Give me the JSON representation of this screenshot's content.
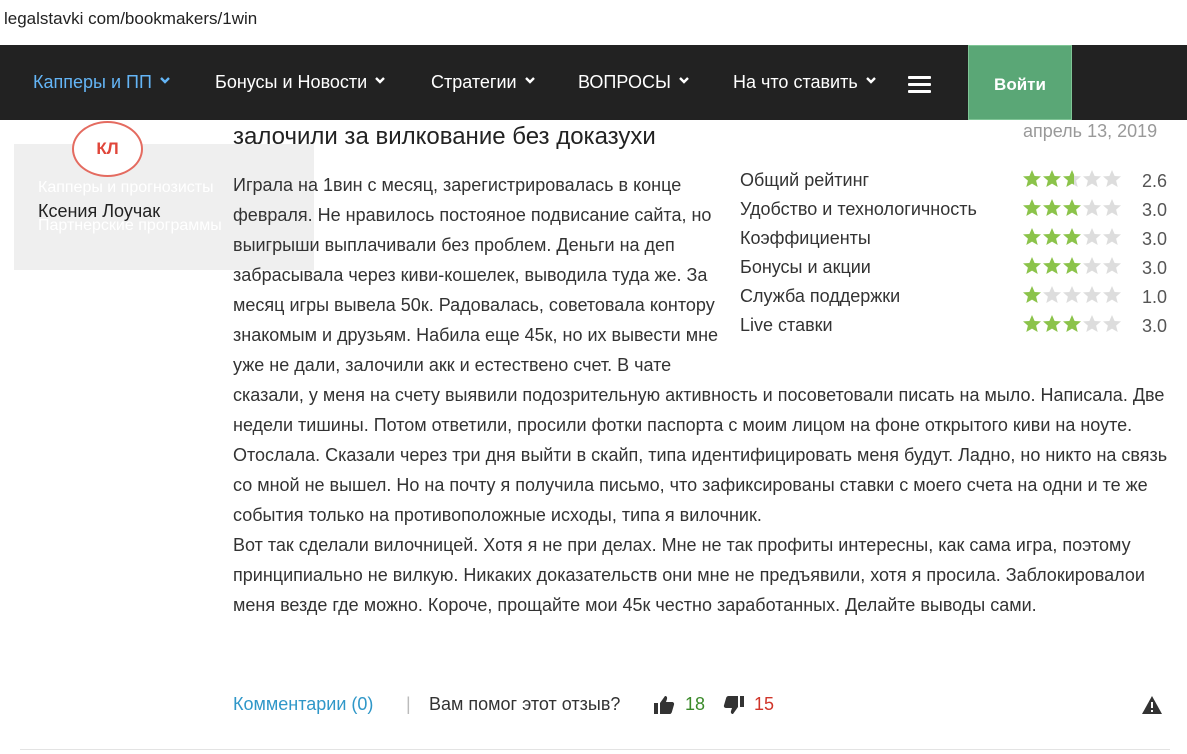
{
  "browser": {
    "url": "legalstavki com/bookmakers/1win"
  },
  "nav": {
    "items": [
      {
        "label": "Капперы и ПП",
        "active": true
      },
      {
        "label": "Бонусы и Новости",
        "active": false
      },
      {
        "label": "Стратегии",
        "active": false
      },
      {
        "label": "ВОПРОСЫ",
        "active": false
      },
      {
        "label": "На что ставить",
        "active": false
      }
    ],
    "menu_icon": "hamburger-icon",
    "login_label": "Войти"
  },
  "sidebar": {
    "ghost_item_1": "Капперы и прогнозисты",
    "ghost_item_2": "Партнерские программы"
  },
  "review": {
    "author_initials": "КЛ",
    "author_name": "Ксения Лоучак",
    "title": "залочили за вилкование без доказухи",
    "date": "апрель 13, 2019",
    "ratings": [
      {
        "label": "Общий рейтинг",
        "value": "2.6",
        "stars": 2.6
      },
      {
        "label": "Удобство и технологичность",
        "value": "3.0",
        "stars": 3
      },
      {
        "label": "Коэффициенты",
        "value": "3.0",
        "stars": 3
      },
      {
        "label": "Бонусы и акции",
        "value": "3.0",
        "stars": 3
      },
      {
        "label": "Служба поддержки",
        "value": "1.0",
        "stars": 1
      },
      {
        "label": "Live ставки",
        "value": "3.0",
        "stars": 3
      }
    ],
    "body_paragraph_1": "Играла на 1вин с месяц, зарегистрировалась в конце февраля. Не нравилось постояное подвисание сайта, но выигрыши выплачивали без проблем. Деньги на деп забрасывала через киви-кошелек, выводила туда же. За месяц игры вывела 50к. Радовалась, советовала контору знакомым и друзьям. Набила еще 45к, но их вывести мне уже не дали, залочили акк и естествено счет. В чате сказали, у меня на счету выявили подозрительную активность и посоветовали писать на мыло. Написала. Две недели тишины. Потом ответили, просили фотки паспорта с моим лицом на фоне открытого киви на ноуте. Отослала. Сказали через три дня выйти в скайп, типа идентифицировать меня будут. Ладно, но никто на связь со мной не вышел. Но на почту я получила письмо, что зафиксированы ставки с моего счета на одни и те же события только на противоположные исходы, типа я вилочник.",
    "body_paragraph_2": "Вот так сделали вилочницей. Хотя я не при делах. Мне не так профиты интересны, как сама игра, поэтому принципиально не вилкую. Никаких доказательств они мне не предъявили, хотя я просила. Заблокировалои меня везде где можно. Короче, прощайте мои 45к честно заработанных. Делайте выводы сами."
  },
  "footer": {
    "comments_label": "Комментарии (0)",
    "separator": "|",
    "helpful_question": "Вам помог этот отзыв?",
    "likes": "18",
    "dislikes": "15"
  },
  "colors": {
    "nav_bg": "#222222",
    "nav_active": "#64b5f6",
    "login_bg": "#5aa776",
    "star_filled": "#8bc34a",
    "star_empty": "#dddddd",
    "link": "#2f97c8",
    "likes": "#3a8a2a",
    "dislikes": "#d0352a",
    "avatar": "#e0463a"
  }
}
